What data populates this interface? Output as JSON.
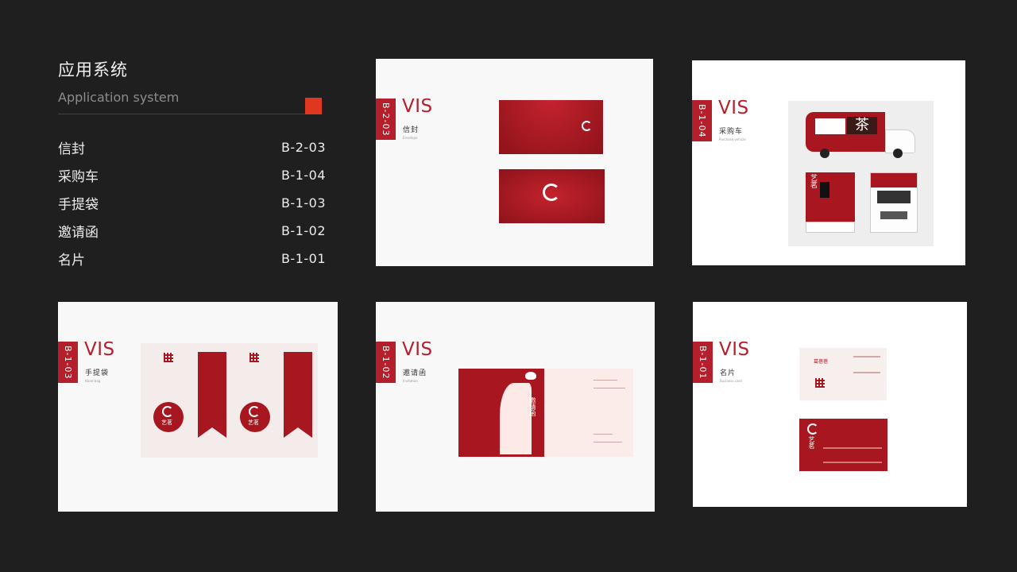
{
  "sidebar": {
    "title": "应用系统",
    "subtitle": "Application system",
    "accent_color": "#e0381e",
    "items": [
      {
        "label": "信封",
        "code": "B-2-03"
      },
      {
        "label": "采购车",
        "code": "B-1-04"
      },
      {
        "label": "手提袋",
        "code": "B-1-03"
      },
      {
        "label": "邀请函",
        "code": "B-1-02"
      },
      {
        "label": "名片",
        "code": "B-1-01"
      }
    ]
  },
  "cards": {
    "envelope": {
      "tag": "B-2-03",
      "vis": "VIS",
      "name": "信封",
      "ename": "Envelope"
    },
    "truck": {
      "tag": "B-1-04",
      "vis": "VIS",
      "name": "采购车",
      "ename": "Purchase vehicle",
      "sign": "茶",
      "brand": "艺茗"
    },
    "bag": {
      "tag": "B-1-03",
      "vis": "VIS",
      "name": "手提袋",
      "ename": "Hand bag",
      "brand": "艺茗"
    },
    "invitation": {
      "tag": "B-1-02",
      "vis": "VIS",
      "name": "邀请函",
      "ename": "Invitation",
      "cover_text": "邀请函"
    },
    "card": {
      "tag": "B-1-01",
      "vis": "VIS",
      "name": "名片",
      "ename": "Business card",
      "person": "葛蓓蓓",
      "brand": "艺茗"
    }
  },
  "brand_color": "#b51f2b"
}
